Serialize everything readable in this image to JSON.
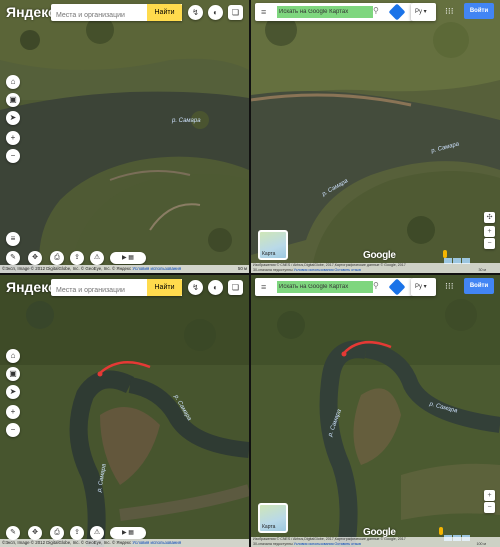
{
  "yandex": {
    "logo": "Яндекс",
    "search_placeholder": "Места и организации",
    "search_button": "Найти",
    "footer_text": "©Эксп, Image © 2012 DigitalGlobe, Inc. © GeoEye, Inc. © Яндекс",
    "footer_terms": "Условия использования",
    "scale_label": "50 м"
  },
  "google": {
    "search_value": "Искать на Google Картах",
    "lang": "Ру",
    "sign_in": "Войти",
    "logo": "Google",
    "thumb_label": "Карта",
    "footer_line1": "Изображения © CNES / Airbus,DigitalGlobe, 2017,Картографические данные © Google, 2017",
    "footer_line2": "30-сначала недоступны",
    "footer_terms": "Условия использования",
    "footer_report": "Оставить отзыв",
    "scale_top": "30 м",
    "scale_bottom": "100 м"
  },
  "river": {
    "name": "р. Самара"
  },
  "colors": {
    "yandex_yellow": "#ffdb4d",
    "google_blue": "#4285f4",
    "route_red": "#e53935"
  },
  "icons": [
    "menu-icon",
    "search-icon",
    "directions-icon",
    "apps-grid-icon",
    "location-icon",
    "zoom-in-icon",
    "zoom-out-icon",
    "layers-icon",
    "ruler-icon",
    "traffic-icon",
    "panorama-icon",
    "share-icon",
    "print-icon"
  ]
}
